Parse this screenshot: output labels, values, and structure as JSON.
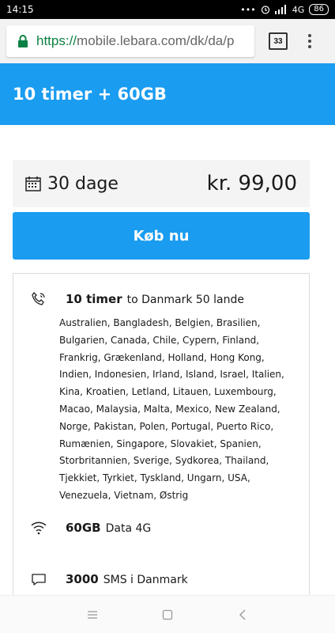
{
  "status": {
    "time": "14:15",
    "dots": "•••",
    "network": "4G",
    "battery": "86"
  },
  "browser": {
    "url_scheme": "https://",
    "url_rest": "mobile.lebara.com/dk/da/p",
    "tab_count": "33"
  },
  "header": {
    "title": "10 timer + 60GB"
  },
  "plan": {
    "duration": "30 dage",
    "price": "kr. 99,00",
    "buy_label": "Køb nu"
  },
  "features": {
    "calls_bold": "10 timer",
    "calls_text": "to Danmark 50 lande",
    "countries_list": "Australien, Bangladesh, Belgien, Brasilien, Bulgarien, Canada, Chile, Cypern, Finland, Frankrig, Grækenland, Holland, Hong Kong, Indien, Indonesien, Irland, Island, Israel, Italien, Kina, Kroatien, Letland, Litauen, Luxembourg, Macao, Malaysia, Malta, Mexico, New Zealand, Norge, Pakistan, Polen, Portugal, Puerto Rico, Rumænien, Singapore, Slovakiet, Spanien, Storbritannien, Sverige, Sydkorea, Thailand, Tjekkiet, Tyrkiet, Tyskland, Ungarn, USA, Venezuela, Vietnam, Østrig",
    "data_bold": "60GB",
    "data_text": "Data 4G",
    "sms_bold": "3000",
    "sms_text": "SMS i Danmark"
  },
  "icons": {
    "lock": "lock-icon",
    "calendar": "calendar-icon",
    "phone": "phone-icon",
    "wifi": "wifi-icon",
    "chat": "chat-bubble-icon",
    "menu": "menu-icon",
    "home": "square-icon",
    "back": "back-icon"
  },
  "colors": {
    "brand_blue": "#1a9cf0",
    "secure_green": "#0b8043"
  }
}
